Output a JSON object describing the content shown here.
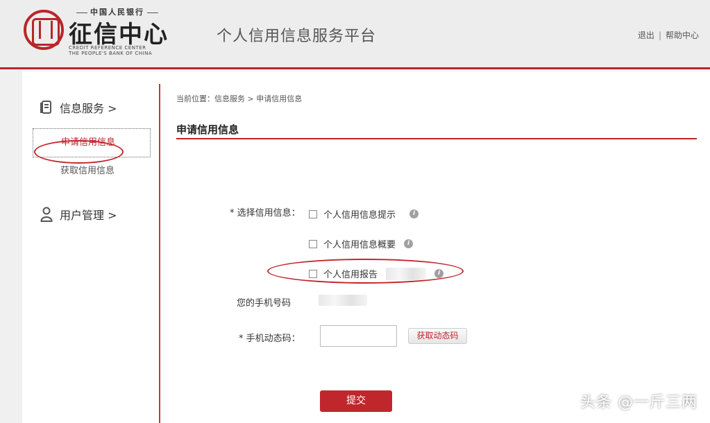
{
  "header": {
    "logo_top": "中国人民银行",
    "logo_name": "征信中心",
    "logo_en_line1": "CREDIT REFERENCE CENTER",
    "logo_en_line2": "THE PEOPLE'S BANK OF CHINA",
    "platform_title": "个人信用信息服务平台",
    "links": {
      "logout": "退出",
      "separator": "|",
      "help": "帮助中心"
    }
  },
  "sidebar": {
    "group1": {
      "label": "信息服务 >",
      "icon": "document-icon"
    },
    "items": [
      {
        "label": "申请信用信息",
        "active": true
      },
      {
        "label": "获取信用信息",
        "active": false
      }
    ],
    "group2": {
      "label": "用户管理 >",
      "icon": "user-icon"
    }
  },
  "content": {
    "breadcrumb": "当前位置：信息服务 > 申请信用信息",
    "page_title": "申请信用信息",
    "select_label": "* 选择信用信息：",
    "options": [
      {
        "label": "个人信用信息提示",
        "checked": false
      },
      {
        "label": "个人信用信息概要",
        "checked": false
      },
      {
        "label": "个人信用报告",
        "checked": false
      }
    ],
    "phone_label": "您的手机号码",
    "code_label": "* 手机动态码：",
    "code_value": "",
    "get_code_button": "获取动态码",
    "submit_button": "提交",
    "info_icon_glyph": "i"
  },
  "watermark": "头条 @一斤三两",
  "colors": {
    "accent": "#b8262a",
    "submit": "#c0272d"
  }
}
